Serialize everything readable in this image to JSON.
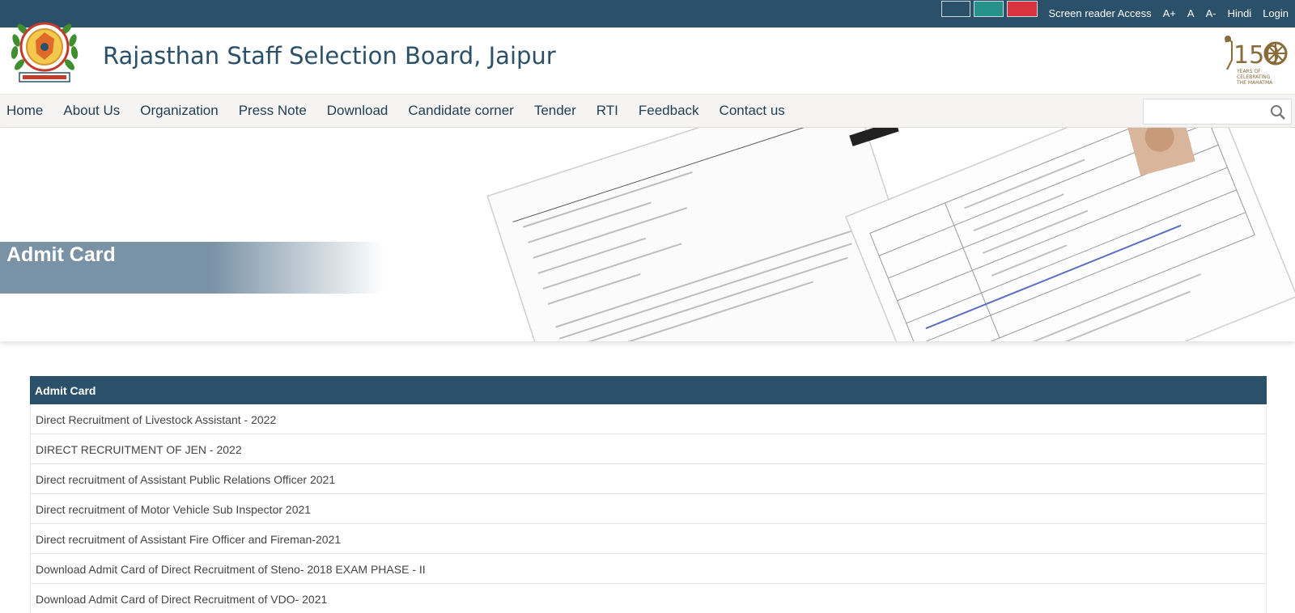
{
  "topbar": {
    "themes": [
      "#2b5069",
      "#26928a",
      "#d9333f"
    ],
    "links": [
      "Screen reader Access",
      "A+",
      "A",
      "A-",
      "Hindi",
      "Login"
    ]
  },
  "header": {
    "title": "Rajasthan Staff Selection Board, Jaipur",
    "badge_number": "150",
    "badge_text_1": "YEARS OF",
    "badge_text_2": "CELEBRATING",
    "badge_text_3": "THE MAHATMA"
  },
  "nav": {
    "items": [
      "Home",
      "About Us",
      "Organization",
      "Press Note",
      "Download",
      "Candidate corner",
      "Tender",
      "RTI",
      "Feedback",
      "Contact us"
    ],
    "search_placeholder": ""
  },
  "banner": {
    "title": "Admit Card"
  },
  "table": {
    "header": "Admit Card",
    "rows": [
      "Direct Recruitment of Livestock Assistant - 2022",
      "DIRECT RECRUITMENT OF JEN - 2022",
      "Direct recruitment of Assistant Public Relations Officer 2021",
      "Direct recruitment of Motor Vehicle Sub Inspector 2021",
      "Direct recruitment of Assistant Fire Officer and Fireman-2021",
      "Download Admit Card of Direct Recruitment of Steno- 2018 EXAM PHASE - II",
      "Download Admit Card of Direct Recruitment of VDO- 2021"
    ]
  },
  "colors": {
    "primary": "#2b5069",
    "nav_bg": "#f5f4f2"
  }
}
